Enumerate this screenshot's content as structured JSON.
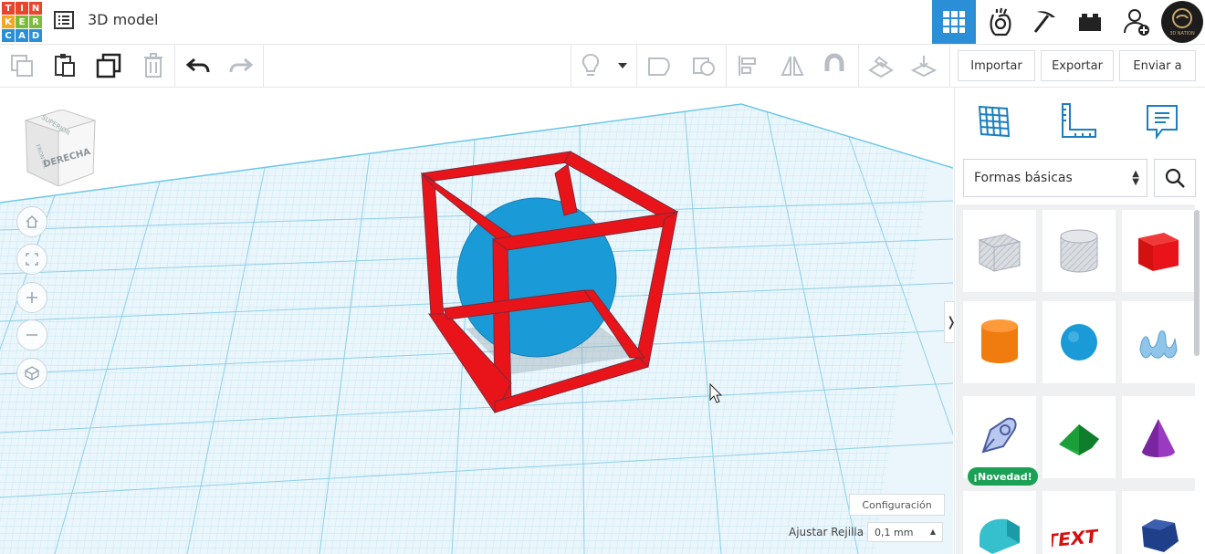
{
  "app": {
    "logo_letters": [
      "T",
      "I",
      "N",
      "K",
      "E",
      "R",
      "C",
      "A",
      "D"
    ],
    "title": "3D model"
  },
  "header": {
    "mode_icons": [
      "grid-view-icon",
      "hand-icon",
      "pickaxe-icon",
      "bricks-icon",
      "add-user-icon"
    ],
    "avatar_text": "3D NATION"
  },
  "toolbar": {
    "import_label": "Importar",
    "export_label": "Exportar",
    "send_label": "Enviar a"
  },
  "viewcube": {
    "right_label": "DERECHA",
    "top_label": "SUPERIOR",
    "front_label": "FRONTAL"
  },
  "panel": {
    "category_select": "Formas básicas",
    "new_badge": "¡Novedad!",
    "shapes": [
      "box-hole",
      "cylinder-hole",
      "box",
      "cylinder",
      "sphere",
      "scribble",
      "shape-generator",
      "roof",
      "cone",
      "round-roof",
      "text",
      "polygon"
    ]
  },
  "footer": {
    "config_label": "Configuración",
    "snap_grid_label": "Ajustar Rejilla",
    "snap_grid_value": "0,1 mm"
  },
  "colors": {
    "accent": "#2a8fd6",
    "cube_red": "#e8141a",
    "sphere_blue": "#1a9bd7",
    "grid_bg": "#e8f5fb",
    "badge_green": "#1aa155"
  }
}
